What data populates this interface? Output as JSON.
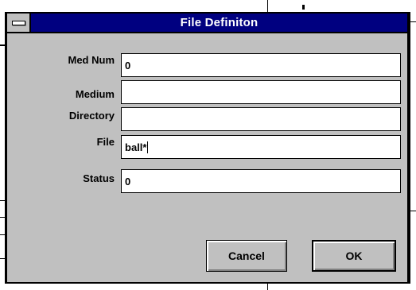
{
  "dialog": {
    "title": "File Definiton",
    "fields": [
      {
        "label": "Med Num",
        "value": "0"
      },
      {
        "label": "Medium",
        "value": ""
      },
      {
        "label": "Directory",
        "value": ""
      },
      {
        "label": "File",
        "value": "ball*"
      },
      {
        "label": "Status",
        "value": "0"
      }
    ],
    "buttons": {
      "cancel": "Cancel",
      "ok": "OK"
    }
  },
  "colors": {
    "titlebar": "#000080",
    "face": "#c0c0c0"
  },
  "icons": {
    "system_menu": "system-menu-icon"
  }
}
